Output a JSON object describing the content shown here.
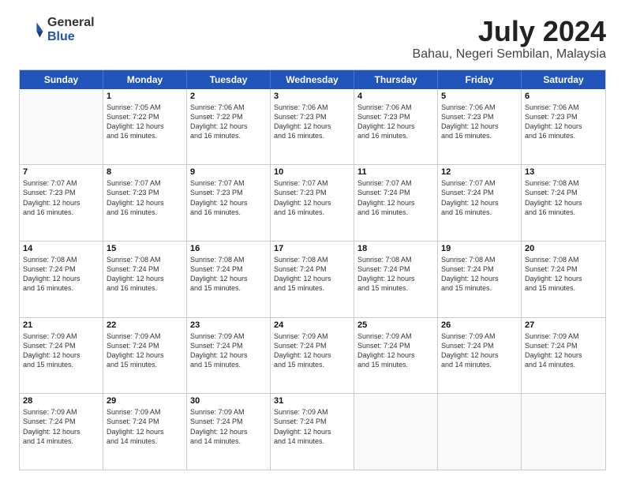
{
  "logo": {
    "general": "General",
    "blue": "Blue"
  },
  "header": {
    "title": "July 2024",
    "subtitle": "Bahau, Negeri Sembilan, Malaysia"
  },
  "weekdays": [
    "Sunday",
    "Monday",
    "Tuesday",
    "Wednesday",
    "Thursday",
    "Friday",
    "Saturday"
  ],
  "weeks": [
    [
      {
        "day": "",
        "empty": true
      },
      {
        "day": "1",
        "lines": [
          "Sunrise: 7:05 AM",
          "Sunset: 7:22 PM",
          "Daylight: 12 hours",
          "and 16 minutes."
        ]
      },
      {
        "day": "2",
        "lines": [
          "Sunrise: 7:06 AM",
          "Sunset: 7:22 PM",
          "Daylight: 12 hours",
          "and 16 minutes."
        ]
      },
      {
        "day": "3",
        "lines": [
          "Sunrise: 7:06 AM",
          "Sunset: 7:23 PM",
          "Daylight: 12 hours",
          "and 16 minutes."
        ]
      },
      {
        "day": "4",
        "lines": [
          "Sunrise: 7:06 AM",
          "Sunset: 7:23 PM",
          "Daylight: 12 hours",
          "and 16 minutes."
        ]
      },
      {
        "day": "5",
        "lines": [
          "Sunrise: 7:06 AM",
          "Sunset: 7:23 PM",
          "Daylight: 12 hours",
          "and 16 minutes."
        ]
      },
      {
        "day": "6",
        "lines": [
          "Sunrise: 7:06 AM",
          "Sunset: 7:23 PM",
          "Daylight: 12 hours",
          "and 16 minutes."
        ]
      }
    ],
    [
      {
        "day": "7",
        "lines": [
          "Sunrise: 7:07 AM",
          "Sunset: 7:23 PM",
          "Daylight: 12 hours",
          "and 16 minutes."
        ]
      },
      {
        "day": "8",
        "lines": [
          "Sunrise: 7:07 AM",
          "Sunset: 7:23 PM",
          "Daylight: 12 hours",
          "and 16 minutes."
        ]
      },
      {
        "day": "9",
        "lines": [
          "Sunrise: 7:07 AM",
          "Sunset: 7:23 PM",
          "Daylight: 12 hours",
          "and 16 minutes."
        ]
      },
      {
        "day": "10",
        "lines": [
          "Sunrise: 7:07 AM",
          "Sunset: 7:23 PM",
          "Daylight: 12 hours",
          "and 16 minutes."
        ]
      },
      {
        "day": "11",
        "lines": [
          "Sunrise: 7:07 AM",
          "Sunset: 7:24 PM",
          "Daylight: 12 hours",
          "and 16 minutes."
        ]
      },
      {
        "day": "12",
        "lines": [
          "Sunrise: 7:07 AM",
          "Sunset: 7:24 PM",
          "Daylight: 12 hours",
          "and 16 minutes."
        ]
      },
      {
        "day": "13",
        "lines": [
          "Sunrise: 7:08 AM",
          "Sunset: 7:24 PM",
          "Daylight: 12 hours",
          "and 16 minutes."
        ]
      }
    ],
    [
      {
        "day": "14",
        "lines": [
          "Sunrise: 7:08 AM",
          "Sunset: 7:24 PM",
          "Daylight: 12 hours",
          "and 16 minutes."
        ]
      },
      {
        "day": "15",
        "lines": [
          "Sunrise: 7:08 AM",
          "Sunset: 7:24 PM",
          "Daylight: 12 hours",
          "and 16 minutes."
        ]
      },
      {
        "day": "16",
        "lines": [
          "Sunrise: 7:08 AM",
          "Sunset: 7:24 PM",
          "Daylight: 12 hours",
          "and 15 minutes."
        ]
      },
      {
        "day": "17",
        "lines": [
          "Sunrise: 7:08 AM",
          "Sunset: 7:24 PM",
          "Daylight: 12 hours",
          "and 15 minutes."
        ]
      },
      {
        "day": "18",
        "lines": [
          "Sunrise: 7:08 AM",
          "Sunset: 7:24 PM",
          "Daylight: 12 hours",
          "and 15 minutes."
        ]
      },
      {
        "day": "19",
        "lines": [
          "Sunrise: 7:08 AM",
          "Sunset: 7:24 PM",
          "Daylight: 12 hours",
          "and 15 minutes."
        ]
      },
      {
        "day": "20",
        "lines": [
          "Sunrise: 7:08 AM",
          "Sunset: 7:24 PM",
          "Daylight: 12 hours",
          "and 15 minutes."
        ]
      }
    ],
    [
      {
        "day": "21",
        "lines": [
          "Sunrise: 7:09 AM",
          "Sunset: 7:24 PM",
          "Daylight: 12 hours",
          "and 15 minutes."
        ]
      },
      {
        "day": "22",
        "lines": [
          "Sunrise: 7:09 AM",
          "Sunset: 7:24 PM",
          "Daylight: 12 hours",
          "and 15 minutes."
        ]
      },
      {
        "day": "23",
        "lines": [
          "Sunrise: 7:09 AM",
          "Sunset: 7:24 PM",
          "Daylight: 12 hours",
          "and 15 minutes."
        ]
      },
      {
        "day": "24",
        "lines": [
          "Sunrise: 7:09 AM",
          "Sunset: 7:24 PM",
          "Daylight: 12 hours",
          "and 15 minutes."
        ]
      },
      {
        "day": "25",
        "lines": [
          "Sunrise: 7:09 AM",
          "Sunset: 7:24 PM",
          "Daylight: 12 hours",
          "and 15 minutes."
        ]
      },
      {
        "day": "26",
        "lines": [
          "Sunrise: 7:09 AM",
          "Sunset: 7:24 PM",
          "Daylight: 12 hours",
          "and 14 minutes."
        ]
      },
      {
        "day": "27",
        "lines": [
          "Sunrise: 7:09 AM",
          "Sunset: 7:24 PM",
          "Daylight: 12 hours",
          "and 14 minutes."
        ]
      }
    ],
    [
      {
        "day": "28",
        "lines": [
          "Sunrise: 7:09 AM",
          "Sunset: 7:24 PM",
          "Daylight: 12 hours",
          "and 14 minutes."
        ]
      },
      {
        "day": "29",
        "lines": [
          "Sunrise: 7:09 AM",
          "Sunset: 7:24 PM",
          "Daylight: 12 hours",
          "and 14 minutes."
        ]
      },
      {
        "day": "30",
        "lines": [
          "Sunrise: 7:09 AM",
          "Sunset: 7:24 PM",
          "Daylight: 12 hours",
          "and 14 minutes."
        ]
      },
      {
        "day": "31",
        "lines": [
          "Sunrise: 7:09 AM",
          "Sunset: 7:24 PM",
          "Daylight: 12 hours",
          "and 14 minutes."
        ]
      },
      {
        "day": "",
        "empty": true
      },
      {
        "day": "",
        "empty": true
      },
      {
        "day": "",
        "empty": true
      }
    ]
  ]
}
